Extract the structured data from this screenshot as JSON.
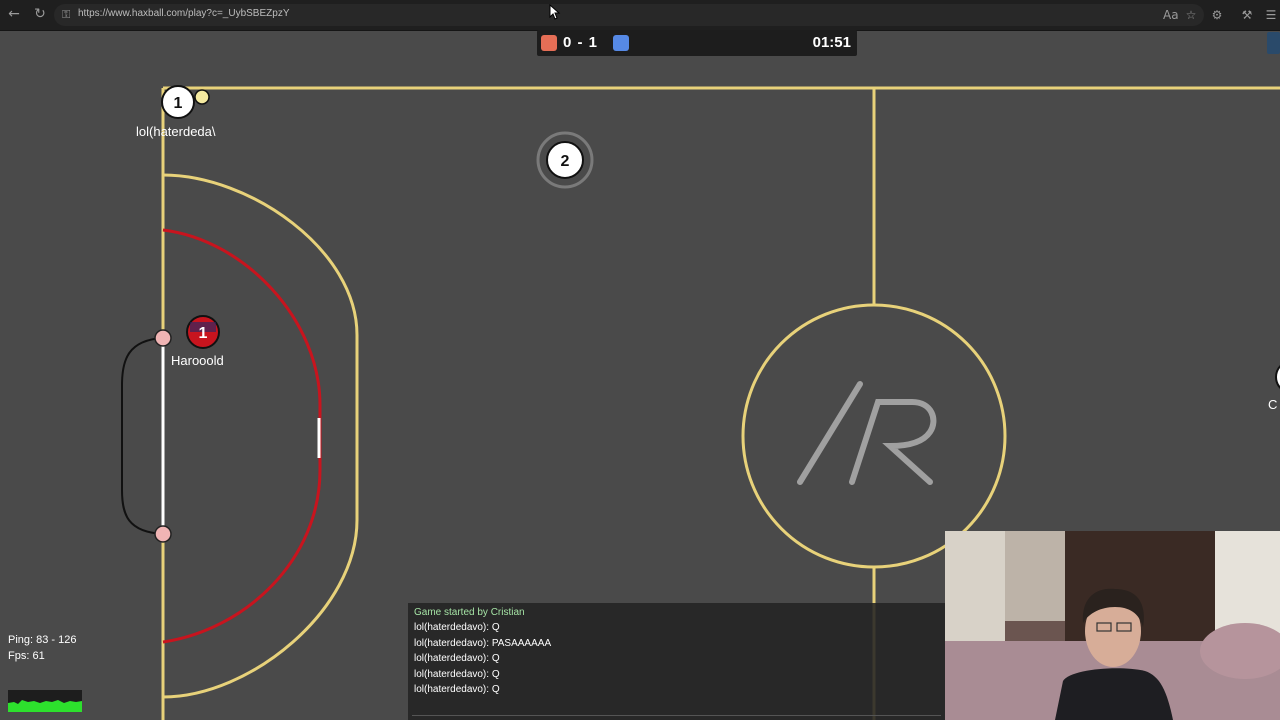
{
  "browser": {
    "url": "https://www.haxball.com/play?c=_UybSBEZpzY",
    "icons": [
      "back-arrow-icon",
      "reload-icon",
      "lock-icon",
      "translate-icon",
      "star-icon",
      "extensions-icon",
      "settings-icon",
      "bookmark-icon"
    ]
  },
  "scoreboard": {
    "score": "0 - 1",
    "time": "01:51",
    "red_color": "#e56e56",
    "blue_color": "#5689e5"
  },
  "players": [
    {
      "number": "1",
      "name": "lol(haterdeda\\",
      "team": "spectator-white"
    },
    {
      "number": "2",
      "name": "",
      "team": "ball-marker"
    },
    {
      "number": "1",
      "name": "Harooold",
      "team": "red"
    },
    {
      "number": "",
      "name": "C",
      "team": "offscreen"
    }
  ],
  "stats": {
    "ping": "Ping: 83 - 126",
    "fps": "Fps: 61"
  },
  "chat": {
    "lines": [
      "Game started by Cristian",
      "lol(haterdedavo): Q",
      "lol(haterdedavo): PASAAAAAA",
      "lol(haterdedavo): Q",
      "lol(haterdedavo): Q",
      "lol(haterdedavo): Q"
    ]
  },
  "colors": {
    "field": "#4a4a4a",
    "lines": "#e8d27a",
    "red_area": "#c8141e",
    "post": "#f0b4b4"
  }
}
